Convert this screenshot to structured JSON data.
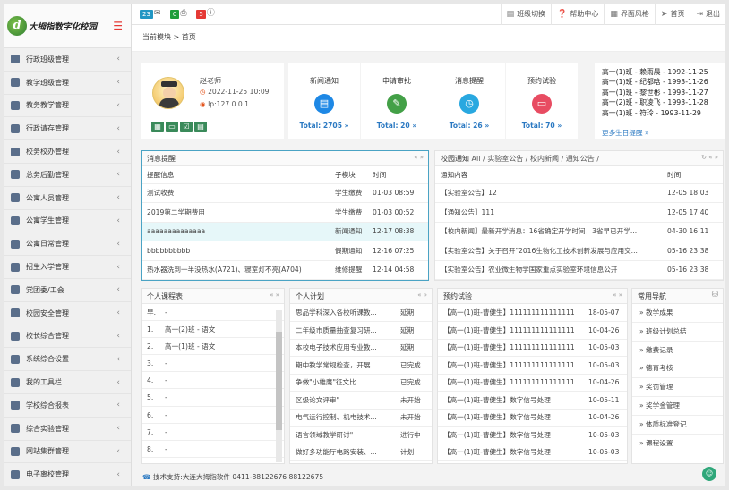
{
  "app": {
    "title": "大拇指数字化校园",
    "brand_color": "#2e7d32",
    "accent": "#e53935"
  },
  "topbar": {
    "badges": [
      {
        "value": "23",
        "color": "#2196c3",
        "icon": "chat-icon"
      },
      {
        "value": "0",
        "color": "#1e9e3b",
        "icon": "printer-icon"
      },
      {
        "value": "5",
        "color": "#e53935",
        "icon": "info-icon"
      }
    ],
    "buttons": [
      {
        "label": "班级切换",
        "icon": "switch-icon"
      },
      {
        "label": "帮助中心",
        "icon": "help-icon"
      },
      {
        "label": "界面风格",
        "icon": "layout-icon"
      },
      {
        "label": "首页",
        "icon": "send-icon"
      },
      {
        "label": "退出",
        "icon": "logout-icon"
      }
    ]
  },
  "breadcrumb": {
    "current": "当前模块",
    "sep": ">",
    "page": "首页"
  },
  "sidebar": {
    "items": [
      {
        "label": "行政班级管理"
      },
      {
        "label": "教学班级管理"
      },
      {
        "label": "教务教学管理"
      },
      {
        "label": "行政请存管理"
      },
      {
        "label": "校务校办管理"
      },
      {
        "label": "总务后勤管理"
      },
      {
        "label": "公寓人员管理"
      },
      {
        "label": "公寓学生管理"
      },
      {
        "label": "公寓日常管理"
      },
      {
        "label": "招生入学管理"
      },
      {
        "label": "党团委/工会"
      },
      {
        "label": "校园安全管理"
      },
      {
        "label": "校长综合管理"
      },
      {
        "label": "系统综合设置"
      },
      {
        "label": "我的工具栏"
      },
      {
        "label": "学校综合报表"
      },
      {
        "label": "综合实验管理"
      },
      {
        "label": "网站集群管理"
      },
      {
        "label": "电子离校管理"
      }
    ]
  },
  "profile": {
    "name": "赵老师",
    "time": "2022-11-25 10:09",
    "ip": "Ip:127.0.0.1",
    "actions": [
      "calendar-icon",
      "id-card-icon",
      "check-icon",
      "clipboard-icon"
    ]
  },
  "cards": [
    {
      "title": "新闻通知",
      "total": "Total: 2705 »",
      "color": "#1e88e5",
      "icon": "news-icon"
    },
    {
      "title": "申请审批",
      "total": "Total: 20 »",
      "color": "#43a047",
      "icon": "approve-icon"
    },
    {
      "title": "消息提醒",
      "total": "Total: 26 »",
      "color": "#29a8e0",
      "icon": "bell-icon"
    },
    {
      "title": "预约试验",
      "total": "Total: 70 »",
      "color": "#e84c62",
      "icon": "booking-icon"
    }
  ],
  "birthdays": {
    "lines": [
      "高一(1)班 - 赖雨晨 - 1992-11-25",
      "高一(1)班 - 纪都晗 - 1993-11-26",
      "高一(1)班 - 黎世彬 - 1993-11-27",
      "高一(2)班 - 职凌飞 - 1993-11-28",
      "高一(1)班 - 符玲 - 1993-11-29"
    ],
    "more": "更多生日提醒 »"
  },
  "messages": {
    "title": "消息提醒",
    "headers": [
      "提醒信息",
      "子模块",
      "时间"
    ],
    "rows": [
      {
        "info": "测试收费",
        "module": "学生缴费",
        "time": "01-03 08:59",
        "style": "red"
      },
      {
        "info": "2019第二学期费用",
        "module": "学生缴费",
        "time": "01-03 00:52",
        "style": "redl"
      },
      {
        "info": "aaaaaaaaaaaaaa",
        "module": "新闻通知",
        "time": "12-17 08:38",
        "style": "hl"
      },
      {
        "info": "bbbbbbbbbb",
        "module": "假期通知",
        "time": "12-16 07:25",
        "style": ""
      },
      {
        "info": "热水器洗到一半没热水(A721)、寝室灯不亮(A704)",
        "module": "维修提醒",
        "time": "12-14 04:58",
        "style": ""
      }
    ]
  },
  "campus": {
    "title": "校园通知",
    "filters": "All / 实验室公告 / 校内新闻 / 通知公告 /",
    "headers": [
      "通知内容",
      "时间"
    ],
    "rows": [
      {
        "text": "【实验室公告】12",
        "time": "12-05 18:03"
      },
      {
        "text": "【通知公告】111",
        "time": "12-05 17:40"
      },
      {
        "text": "【校内新闻】最新开学消息：16省确定开学时间！3省早已开学...",
        "time": "04-30 16:11"
      },
      {
        "text": "【实验室公告】关于召开\"2016生物化工技术创新发展与应用交...",
        "time": "05-16 23:38"
      },
      {
        "text": "【实验室公告】农业微生物学国家重点实验室环境信息公开",
        "time": "05-16 23:38"
      }
    ]
  },
  "schedule": {
    "title": "个人课程表",
    "rows": [
      {
        "n": "早.",
        "t": "-"
      },
      {
        "n": "1.",
        "t": "高一(2)班 - 语文"
      },
      {
        "n": "2.",
        "t": "高一(1)班 - 语文"
      },
      {
        "n": "3.",
        "t": "-"
      },
      {
        "n": "4.",
        "t": "-"
      },
      {
        "n": "5.",
        "t": "-"
      },
      {
        "n": "6.",
        "t": "-"
      },
      {
        "n": "7.",
        "t": "-"
      },
      {
        "n": "8.",
        "t": "-"
      }
    ]
  },
  "plans": {
    "title": "个人计划",
    "rows": [
      {
        "t": "思品学科深入各校听课教...",
        "s": "延期"
      },
      {
        "t": "二年级市质量抽查复习研...",
        "s": "延期"
      },
      {
        "t": "本校电子技术应用专业教...",
        "s": "延期"
      },
      {
        "t": "期中教学常规检查，开展...",
        "s": "已完成"
      },
      {
        "t": "争做\"小雄鹰\"征文比...",
        "s": "已完成"
      },
      {
        "t": "区级论文评审\"",
        "s": "未开始"
      },
      {
        "t": "电气运行控制、机电技术...",
        "s": "未开始"
      },
      {
        "t": "语言领域教学研讨\"",
        "s": "进行中"
      },
      {
        "t": "做好多功能厅电路安装、...",
        "s": "计划"
      }
    ]
  },
  "booking": {
    "title": "预约试验",
    "rows": [
      {
        "t": "【高一(1)班-曹健生】111111111111111",
        "d": "18-05-07"
      },
      {
        "t": "【高一(1)班-曹健生】111111111111111",
        "d": "10-04-26"
      },
      {
        "t": "【高一(1)班-曹健生】111111111111111",
        "d": "10-05-03"
      },
      {
        "t": "【高一(1)班-曹健生】111111111111111",
        "d": "10-05-03"
      },
      {
        "t": "【高一(1)班-曹健生】111111111111111",
        "d": "10-04-26"
      },
      {
        "t": "【高一(1)班-曹健生】数字信号处理",
        "d": "10-05-11"
      },
      {
        "t": "【高一(1)班-曹健生】数字信号处理",
        "d": "10-04-26"
      },
      {
        "t": "【高一(1)班-曹健生】数字信号处理",
        "d": "10-05-03"
      },
      {
        "t": "【高一(1)班-曹健生】数字信号处理",
        "d": "10-05-03"
      }
    ]
  },
  "quicknav": {
    "title": "常用导航",
    "items": [
      "» 教学成果",
      "» 班级计划总结",
      "» 缴费记录",
      "» 德育考核",
      "» 奖罚管理",
      "» 奖学金管理",
      "» 体质标准登记",
      "» 课程设置"
    ]
  },
  "footer": {
    "text": "技术支持:大连大拇指软件 0411-88122676 88122675"
  }
}
